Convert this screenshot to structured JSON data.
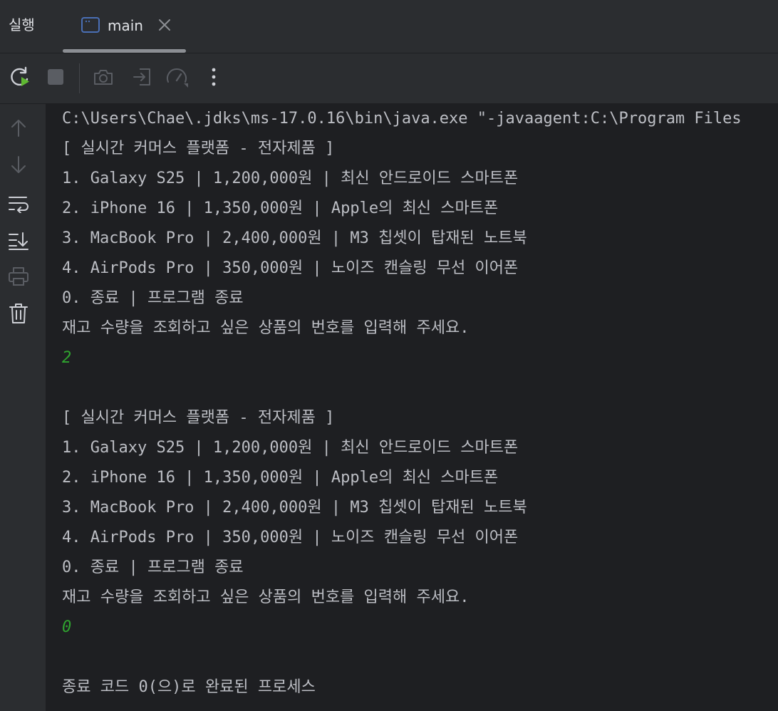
{
  "tabbar": {
    "run_label": "실행",
    "tab": {
      "label": "main",
      "icon": "console-window-icon"
    },
    "close_icon": "close-icon"
  },
  "toolbar": {
    "buttons": [
      {
        "name": "rerun-button",
        "icon": "rerun-icon"
      },
      {
        "name": "stop-button",
        "icon": "stop-icon"
      },
      {
        "name": "screenshot-button",
        "icon": "camera-icon"
      },
      {
        "name": "restore-layout-button",
        "icon": "login-arrow-icon"
      },
      {
        "name": "profiler-button",
        "icon": "speedometer-icon"
      },
      {
        "name": "more-button",
        "icon": "more-vertical-icon"
      }
    ]
  },
  "sidebar": {
    "buttons": [
      {
        "name": "scroll-up-button",
        "icon": "arrow-up-icon"
      },
      {
        "name": "scroll-down-button",
        "icon": "arrow-down-icon"
      },
      {
        "name": "soft-wrap-button",
        "icon": "soft-wrap-icon"
      },
      {
        "name": "scroll-to-end-button",
        "icon": "scroll-to-end-icon"
      },
      {
        "name": "print-button",
        "icon": "printer-icon"
      },
      {
        "name": "clear-all-button",
        "icon": "trash-icon"
      }
    ]
  },
  "colors": {
    "background": "#1e1f22",
    "panel": "#2b2d30",
    "text": "#bcbec4",
    "input_text": "#2fa32f",
    "accent_green": "#5fb832",
    "tab_icon_blue": "#4a6fb5"
  },
  "console": {
    "lines": [
      {
        "text": "C:\\Users\\Chae\\.jdks\\ms-17.0.16\\bin\\java.exe \"-javaagent:C:\\Program Files",
        "kind": "output"
      },
      {
        "text": "[ 실시간 커머스 플랫폼 - 전자제품 ]",
        "kind": "output"
      },
      {
        "text": "1. Galaxy S25 | 1,200,000원 | 최신 안드로이드 스마트폰",
        "kind": "output"
      },
      {
        "text": "2. iPhone 16 | 1,350,000원 | Apple의 최신 스마트폰",
        "kind": "output"
      },
      {
        "text": "3. MacBook Pro | 2,400,000원 | M3 칩셋이 탑재된 노트북",
        "kind": "output"
      },
      {
        "text": "4. AirPods Pro | 350,000원 | 노이즈 캔슬링 무선 이어폰",
        "kind": "output"
      },
      {
        "text": "0. 종료 | 프로그램 종료",
        "kind": "output"
      },
      {
        "text": "재고 수량을 조회하고 싶은 상품의 번호를 입력해 주세요.",
        "kind": "output"
      },
      {
        "text": "2",
        "kind": "input"
      },
      {
        "text": "",
        "kind": "output"
      },
      {
        "text": "[ 실시간 커머스 플랫폼 - 전자제품 ]",
        "kind": "output"
      },
      {
        "text": "1. Galaxy S25 | 1,200,000원 | 최신 안드로이드 스마트폰",
        "kind": "output"
      },
      {
        "text": "2. iPhone 16 | 1,350,000원 | Apple의 최신 스마트폰",
        "kind": "output"
      },
      {
        "text": "3. MacBook Pro | 2,400,000원 | M3 칩셋이 탑재된 노트북",
        "kind": "output"
      },
      {
        "text": "4. AirPods Pro | 350,000원 | 노이즈 캔슬링 무선 이어폰",
        "kind": "output"
      },
      {
        "text": "0. 종료 | 프로그램 종료",
        "kind": "output"
      },
      {
        "text": "재고 수량을 조회하고 싶은 상품의 번호를 입력해 주세요.",
        "kind": "output"
      },
      {
        "text": "0",
        "kind": "input"
      },
      {
        "text": "",
        "kind": "output"
      },
      {
        "text": "종료 코드 0(으)로 완료된 프로세스",
        "kind": "output"
      }
    ]
  }
}
